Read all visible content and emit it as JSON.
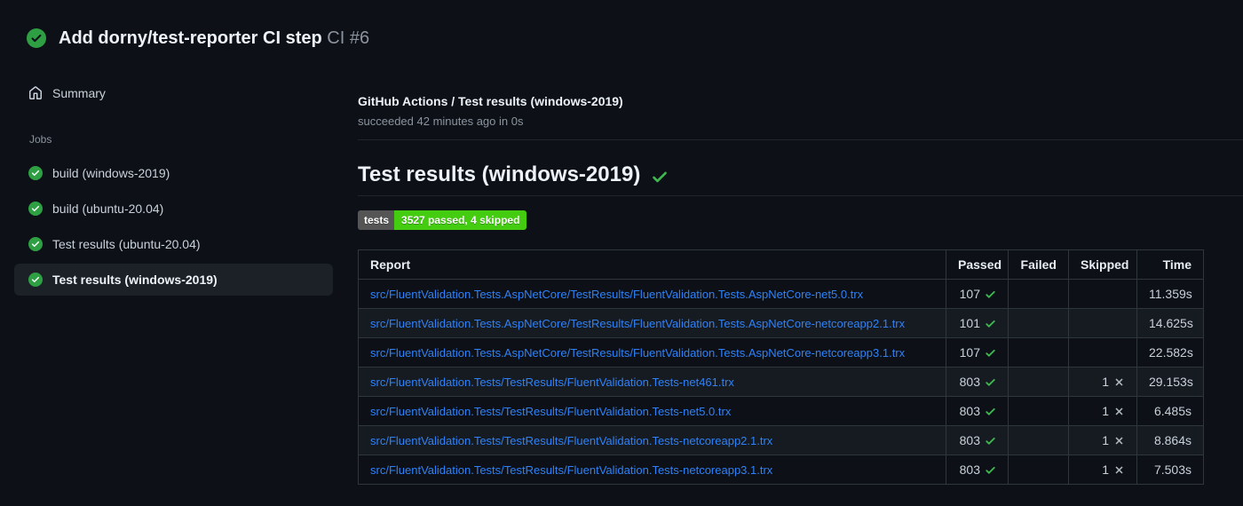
{
  "header": {
    "title": "Add dorny/test-reporter CI step",
    "run_number": "CI #6",
    "status_icon": "check-circle-fill"
  },
  "sidebar": {
    "summary_label": "Summary",
    "summary_icon": "home",
    "jobs_label": "Jobs",
    "job_icon": "check-circle-fill",
    "jobs": [
      {
        "label": "build (windows-2019)",
        "selected": false
      },
      {
        "label": "build (ubuntu-20.04)",
        "selected": false
      },
      {
        "label": "Test results (ubuntu-20.04)",
        "selected": false
      },
      {
        "label": "Test results (windows-2019)",
        "selected": true
      }
    ]
  },
  "main": {
    "run_title": "GitHub Actions / Test results (windows-2019)",
    "run_subtitle": "succeeded 42 minutes ago in 0s",
    "section_title": "Test results (windows-2019)",
    "section_status_icon": "check",
    "badge": {
      "label": "tests",
      "value": "3527 passed, 4 skipped"
    },
    "table": {
      "columns": [
        "Report",
        "Passed",
        "Failed",
        "Skipped",
        "Time"
      ],
      "passed_icon": "check",
      "skipped_icon": "x",
      "rows": [
        {
          "report": "src/FluentValidation.Tests.AspNetCore/TestResults/FluentValidation.Tests.AspNetCore-net5.0.trx",
          "passed": "107",
          "failed": "",
          "skipped": "",
          "time": "11.359s"
        },
        {
          "report": "src/FluentValidation.Tests.AspNetCore/TestResults/FluentValidation.Tests.AspNetCore-netcoreapp2.1.trx",
          "passed": "101",
          "failed": "",
          "skipped": "",
          "time": "14.625s"
        },
        {
          "report": "src/FluentValidation.Tests.AspNetCore/TestResults/FluentValidation.Tests.AspNetCore-netcoreapp3.1.trx",
          "passed": "107",
          "failed": "",
          "skipped": "",
          "time": "22.582s"
        },
        {
          "report": "src/FluentValidation.Tests/TestResults/FluentValidation.Tests-net461.trx",
          "passed": "803",
          "failed": "",
          "skipped": "1",
          "time": "29.153s"
        },
        {
          "report": "src/FluentValidation.Tests/TestResults/FluentValidation.Tests-net5.0.trx",
          "passed": "803",
          "failed": "",
          "skipped": "1",
          "time": "6.485s"
        },
        {
          "report": "src/FluentValidation.Tests/TestResults/FluentValidation.Tests-netcoreapp2.1.trx",
          "passed": "803",
          "failed": "",
          "skipped": "1",
          "time": "8.864s"
        },
        {
          "report": "src/FluentValidation.Tests/TestResults/FluentValidation.Tests-netcoreapp3.1.trx",
          "passed": "803",
          "failed": "",
          "skipped": "1",
          "time": "7.503s"
        }
      ]
    }
  },
  "colors": {
    "background": "#0d1117",
    "row_alt": "#161b22",
    "border": "#30363d",
    "divider": "#21262d",
    "link": "#2f81f7",
    "success": "#3fb950",
    "success_circle": "#2ea043",
    "badge_gray": "#555555",
    "badge_green": "#44cc11",
    "muted": "#8b949e"
  }
}
